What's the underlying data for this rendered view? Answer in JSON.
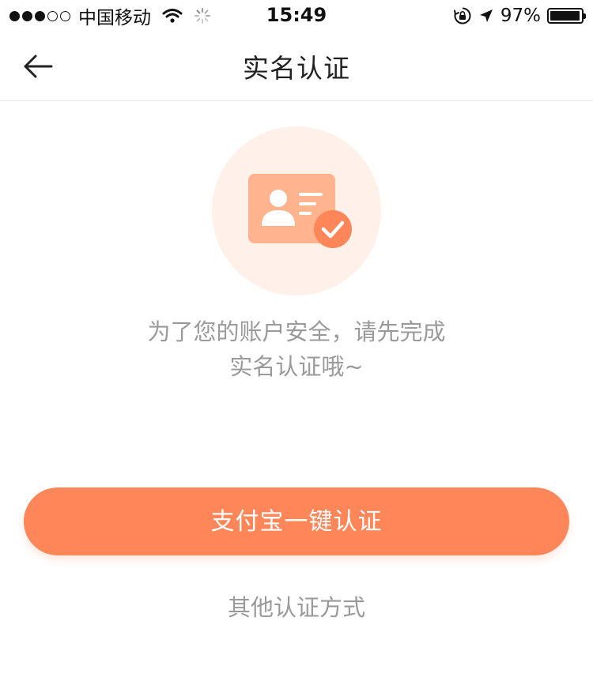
{
  "status_bar": {
    "carrier": "中国移动",
    "time": "15:49",
    "battery_percent": "97%",
    "battery_level": 0.97,
    "signal_bars_filled": 3,
    "signal_bars_total": 5,
    "icons": [
      "wifi-icon",
      "loading-icon",
      "rotation-lock-icon",
      "location-arrow-icon",
      "battery-icon"
    ]
  },
  "nav": {
    "title": "实名认证",
    "back_icon": "back-arrow-icon"
  },
  "illustration": {
    "icon": "id-card-verified-icon",
    "colors": {
      "circle": "#fff0e9",
      "card": "#ffb48e",
      "badge": "#ff8658"
    }
  },
  "message": {
    "line1": "为了您的账户安全，请先完成",
    "line2": "实名认证哦~"
  },
  "actions": {
    "primary_label": "支付宝一键认证",
    "secondary_label": "其他认证方式"
  },
  "colors": {
    "accent": "#ff8658",
    "muted_text": "#9a9a9a",
    "title_text": "#222222"
  }
}
